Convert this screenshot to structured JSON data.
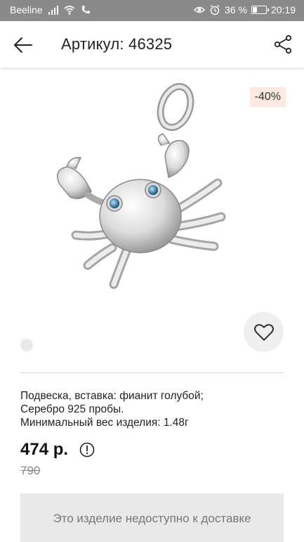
{
  "status_bar": {
    "carrier": "Beeline",
    "battery_percent": "36 %",
    "battery_level": 0.36,
    "time": "20:19",
    "icons": [
      "signal-icon",
      "wifi-icon",
      "call-icon",
      "eye-icon",
      "alarm-icon",
      "battery-icon"
    ]
  },
  "app_bar": {
    "back_icon": "arrow-left-icon",
    "title": "Артикул: 46325",
    "share_icon": "share-icon"
  },
  "product": {
    "image": "silver-crab-pendant",
    "discount_badge": "-40%",
    "favorite_icon": "heart-icon",
    "description_lines": [
      "Подвеска, вставка:  фианит голубой;",
      "Серебро 925 пробы.",
      "Минимальный вес изделия: 1.48г"
    ],
    "price": "474 р.",
    "info_icon": "info-icon",
    "old_price": "790",
    "unavailable_button": "Это изделие недоступно к доставке"
  },
  "colors": {
    "status_bar_bg": "#8a8a8a",
    "badge_bg": "#fbe9e2",
    "button_bg": "#e9e9e9"
  }
}
